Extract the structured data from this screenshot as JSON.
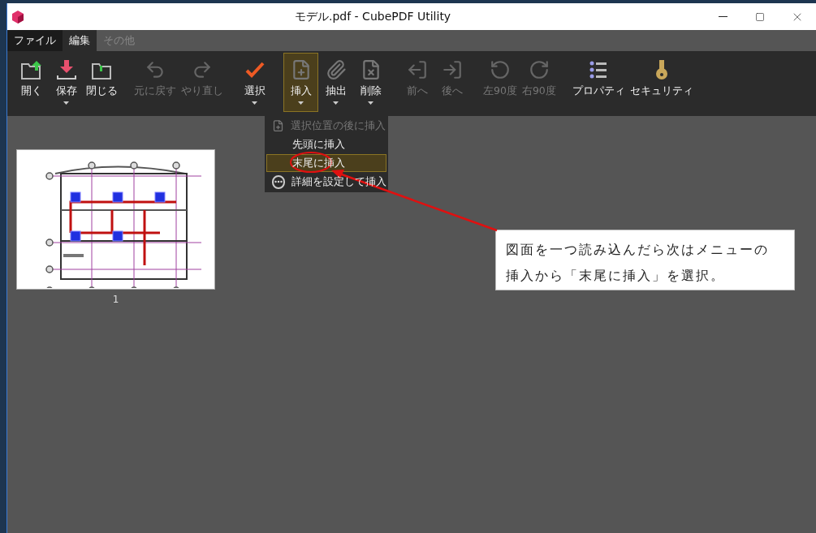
{
  "window": {
    "title": "モデル.pdf - CubePDF Utility"
  },
  "menu_tabs": [
    {
      "label": "ファイル",
      "selected": false
    },
    {
      "label": "編集",
      "selected": true
    },
    {
      "label": "その他",
      "selected": false
    }
  ],
  "toolbar_groups": [
    [
      {
        "label": "開く",
        "dropdown": false,
        "disabled": false,
        "selected": false
      },
      {
        "label": "保存",
        "dropdown": true,
        "disabled": false,
        "selected": false
      },
      {
        "label": "閉じる",
        "dropdown": false,
        "disabled": false,
        "selected": false
      }
    ],
    [
      {
        "label": "元に戻す",
        "dropdown": false,
        "disabled": true,
        "selected": false
      },
      {
        "label": "やり直し",
        "dropdown": false,
        "disabled": true,
        "selected": false
      }
    ],
    [
      {
        "label": "選択",
        "dropdown": true,
        "disabled": false,
        "selected": false
      }
    ],
    [
      {
        "label": "挿入",
        "dropdown": true,
        "disabled": false,
        "selected": true
      },
      {
        "label": "抽出",
        "dropdown": true,
        "disabled": false,
        "selected": false
      },
      {
        "label": "削除",
        "dropdown": true,
        "disabled": false,
        "selected": false
      }
    ],
    [
      {
        "label": "前へ",
        "dropdown": false,
        "disabled": true,
        "selected": false
      },
      {
        "label": "後へ",
        "dropdown": false,
        "disabled": true,
        "selected": false
      }
    ],
    [
      {
        "label": "左90度",
        "dropdown": false,
        "disabled": true,
        "selected": false
      },
      {
        "label": "右90度",
        "dropdown": false,
        "disabled": true,
        "selected": false
      }
    ],
    [
      {
        "label": "プロパティ",
        "dropdown": false,
        "disabled": false,
        "selected": false
      },
      {
        "label": "セキュリティ",
        "dropdown": false,
        "disabled": false,
        "selected": false
      }
    ]
  ],
  "insert_menu": [
    {
      "label": "選択位置の後に挿入",
      "disabled": true,
      "selected": false
    },
    {
      "label": "先頭に挿入",
      "disabled": false,
      "selected": false
    },
    {
      "label": "末尾に挿入",
      "disabled": false,
      "selected": true
    },
    {
      "label": "詳細を設定して挿入",
      "disabled": false,
      "selected": false
    }
  ],
  "pages": [
    {
      "number": "1"
    }
  ],
  "annotation": {
    "text": "図面を一つ読み込んだら次はメニューの挿入から「末尾に挿入」を選択。"
  }
}
